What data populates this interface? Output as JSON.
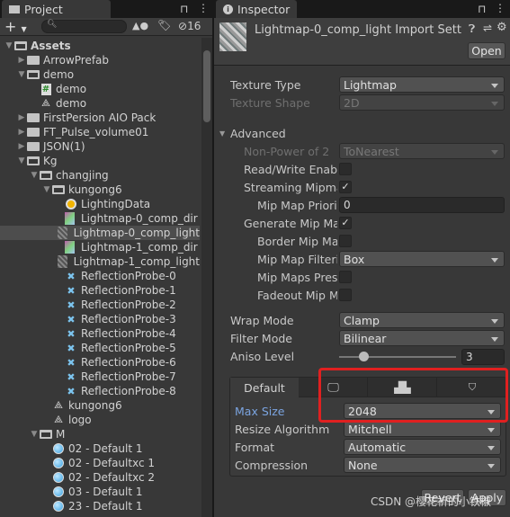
{
  "project": {
    "tab": "Project",
    "filter_count": "16",
    "search_placeholder": "",
    "tree": [
      {
        "label": "Assets",
        "depth": 0,
        "arrow": "open",
        "icon": "folder-open",
        "bold": true
      },
      {
        "label": "ArrowPrefab",
        "depth": 1,
        "arrow": "closed",
        "icon": "folder"
      },
      {
        "label": "demo",
        "depth": 1,
        "arrow": "open",
        "icon": "folder-open"
      },
      {
        "label": "demo",
        "depth": 2,
        "icon": "script"
      },
      {
        "label": "demo",
        "depth": 2,
        "icon": "unity-scene"
      },
      {
        "label": "FirstPersion AIO Pack",
        "depth": 1,
        "arrow": "closed",
        "icon": "folder"
      },
      {
        "label": "FT_Pulse_volume01",
        "depth": 1,
        "arrow": "closed",
        "icon": "folder"
      },
      {
        "label": "JSON(1)",
        "depth": 1,
        "arrow": "closed",
        "icon": "folder"
      },
      {
        "label": "Kg",
        "depth": 1,
        "arrow": "open",
        "icon": "folder-open"
      },
      {
        "label": "changjing",
        "depth": 2,
        "arrow": "open",
        "icon": "folder-open"
      },
      {
        "label": "kungong6",
        "depth": 3,
        "arrow": "open",
        "icon": "folder-open"
      },
      {
        "label": "LightingData",
        "depth": 4,
        "icon": "lighting-data"
      },
      {
        "label": "Lightmap-0_comp_dir",
        "depth": 4,
        "icon": "texture-dir"
      },
      {
        "label": "Lightmap-0_comp_light",
        "depth": 4,
        "icon": "texture-light",
        "selected": true
      },
      {
        "label": "Lightmap-1_comp_dir",
        "depth": 4,
        "icon": "texture-dir"
      },
      {
        "label": "Lightmap-1_comp_light",
        "depth": 4,
        "icon": "texture-light"
      },
      {
        "label": "ReflectionProbe-0",
        "depth": 4,
        "icon": "reflection-probe"
      },
      {
        "label": "ReflectionProbe-1",
        "depth": 4,
        "icon": "reflection-probe"
      },
      {
        "label": "ReflectionProbe-2",
        "depth": 4,
        "icon": "reflection-probe"
      },
      {
        "label": "ReflectionProbe-3",
        "depth": 4,
        "icon": "reflection-probe"
      },
      {
        "label": "ReflectionProbe-4",
        "depth": 4,
        "icon": "reflection-probe"
      },
      {
        "label": "ReflectionProbe-5",
        "depth": 4,
        "icon": "reflection-probe"
      },
      {
        "label": "ReflectionProbe-6",
        "depth": 4,
        "icon": "reflection-probe"
      },
      {
        "label": "ReflectionProbe-7",
        "depth": 4,
        "icon": "reflection-probe"
      },
      {
        "label": "ReflectionProbe-8",
        "depth": 4,
        "icon": "reflection-probe"
      },
      {
        "label": "kungong6",
        "depth": 3,
        "icon": "unity-scene"
      },
      {
        "label": "logo",
        "depth": 3,
        "icon": "unity-scene"
      },
      {
        "label": "M",
        "depth": 2,
        "arrow": "open",
        "icon": "folder-open"
      },
      {
        "label": "02 - Default 1",
        "depth": 3,
        "icon": "material"
      },
      {
        "label": "02 - Defaultxc 1",
        "depth": 3,
        "icon": "material"
      },
      {
        "label": "02 - Defaultxc 2",
        "depth": 3,
        "icon": "material"
      },
      {
        "label": "03 - Default 1",
        "depth": 3,
        "icon": "material"
      },
      {
        "label": "23 - Default 1",
        "depth": 3,
        "icon": "material"
      }
    ]
  },
  "inspector": {
    "tab": "Inspector",
    "title": "Lightmap-0_comp_light Import Settin",
    "open": "Open",
    "texture_type": {
      "label": "Texture Type",
      "value": "Lightmap"
    },
    "texture_shape": {
      "label": "Texture Shape",
      "value": "2D"
    },
    "advanced": "Advanced",
    "non_power": {
      "label": "Non-Power of 2",
      "value": "ToNearest"
    },
    "read_write": {
      "label": "Read/Write Enable",
      "checked": false
    },
    "streaming": {
      "label": "Streaming Mipmap",
      "checked": true
    },
    "priority": {
      "label": "Mip Map Priority",
      "value": "0"
    },
    "generate": {
      "label": "Generate Mip Map",
      "checked": true
    },
    "border": {
      "label": "Border Mip Map",
      "checked": false
    },
    "filtering": {
      "label": "Mip Map Filterin",
      "value": "Box"
    },
    "presets": {
      "label": "Mip Maps Prese",
      "checked": false
    },
    "fadeout": {
      "label": "Fadeout Mip Ma",
      "checked": false
    },
    "wrap": {
      "label": "Wrap Mode",
      "value": "Clamp"
    },
    "filter": {
      "label": "Filter Mode",
      "value": "Bilinear"
    },
    "aniso": {
      "label": "Aniso Level",
      "value": "3"
    },
    "platform_tabs": {
      "default": "Default",
      "icons": [
        "monitor-icon",
        "android-icon",
        "html5-icon"
      ]
    },
    "max_size": {
      "label": "Max Size",
      "value": "2048"
    },
    "resize": {
      "label": "Resize Algorithm",
      "value": "Mitchell"
    },
    "format": {
      "label": "Format",
      "value": "Automatic"
    },
    "compression": {
      "label": "Compression",
      "value": "None"
    },
    "revert": "Revert",
    "apply": "Apply",
    "highlight_color": "#e02020"
  },
  "watermark": "CSDN @樱花祈的小铁椒"
}
